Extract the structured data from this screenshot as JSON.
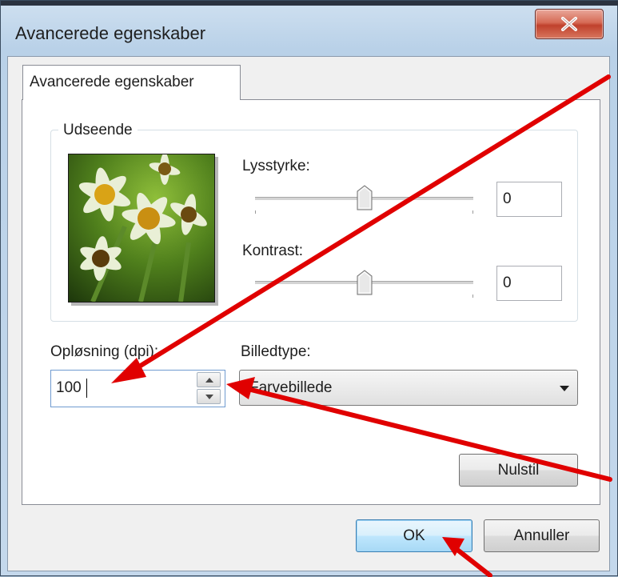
{
  "window": {
    "title": "Avancerede egenskaber",
    "close_label": "x"
  },
  "tabs": [
    {
      "label": "Avancerede egenskaber",
      "selected": true
    }
  ],
  "appearance": {
    "group_label": "Udseende",
    "brightness": {
      "label": "Lysstyrke:",
      "value": "0",
      "slider_level": 0.5
    },
    "contrast": {
      "label": "Kontrast:",
      "value": "0",
      "slider_level": 0.5
    }
  },
  "resolution": {
    "label": "Opløsning (dpi):",
    "value": "100"
  },
  "image_type": {
    "label": "Billedtype:",
    "selected": "Farvebillede"
  },
  "buttons": {
    "reset": "Nulstil",
    "ok": "OK",
    "cancel": "Annuller"
  },
  "colors": {
    "annotation_arrow": "#e00000",
    "default_button_border": "#3c7fb1"
  },
  "icons": {
    "close": "close-icon",
    "spin_up": "spin-up-arrow-icon",
    "spin_down": "spin-down-arrow-icon",
    "dropdown": "chevron-down-icon"
  }
}
